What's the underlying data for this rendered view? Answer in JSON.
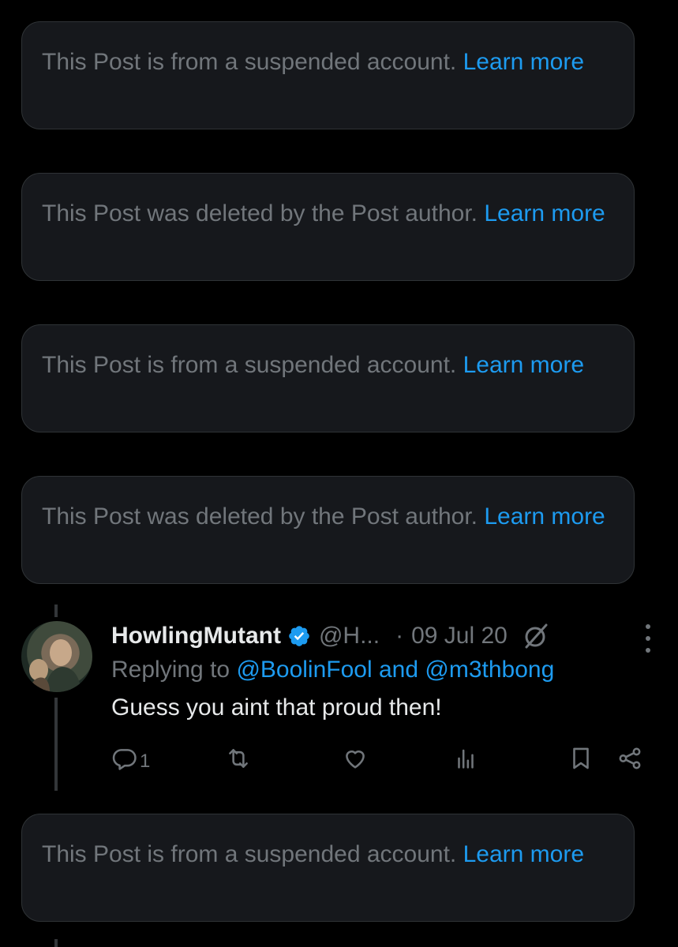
{
  "notices": [
    {
      "text": "This Post is from a suspended account.",
      "link": "Learn more"
    },
    {
      "text": "This Post was deleted by the Post author.",
      "link": "Learn more"
    },
    {
      "text": "This Post is from a suspended account.",
      "link": "Learn more"
    },
    {
      "text": "This Post was deleted by the Post author.",
      "link": "Learn more"
    },
    {
      "text": "This Post is from a suspended account.",
      "link": "Learn more"
    }
  ],
  "post": {
    "display_name": "HowlingMutant",
    "handle": "@H...",
    "separator": "·",
    "date": "09 Jul 20",
    "replying_prefix": "Replying to",
    "mention_1": "@BoolinFool",
    "mention_joiner": "and",
    "mention_2": "@m3thbong",
    "text": "Guess you aint that proud then!",
    "reply_count": "1"
  },
  "colors": {
    "background": "#000000",
    "card": "#16181c",
    "muted": "#71767b",
    "link": "#1d9bf0",
    "text": "#e7e9ea"
  },
  "icons": [
    "verified-badge-icon",
    "grok-icon",
    "more-icon",
    "reply-icon",
    "repost-icon",
    "like-icon",
    "views-icon",
    "bookmark-icon",
    "share-icon"
  ]
}
